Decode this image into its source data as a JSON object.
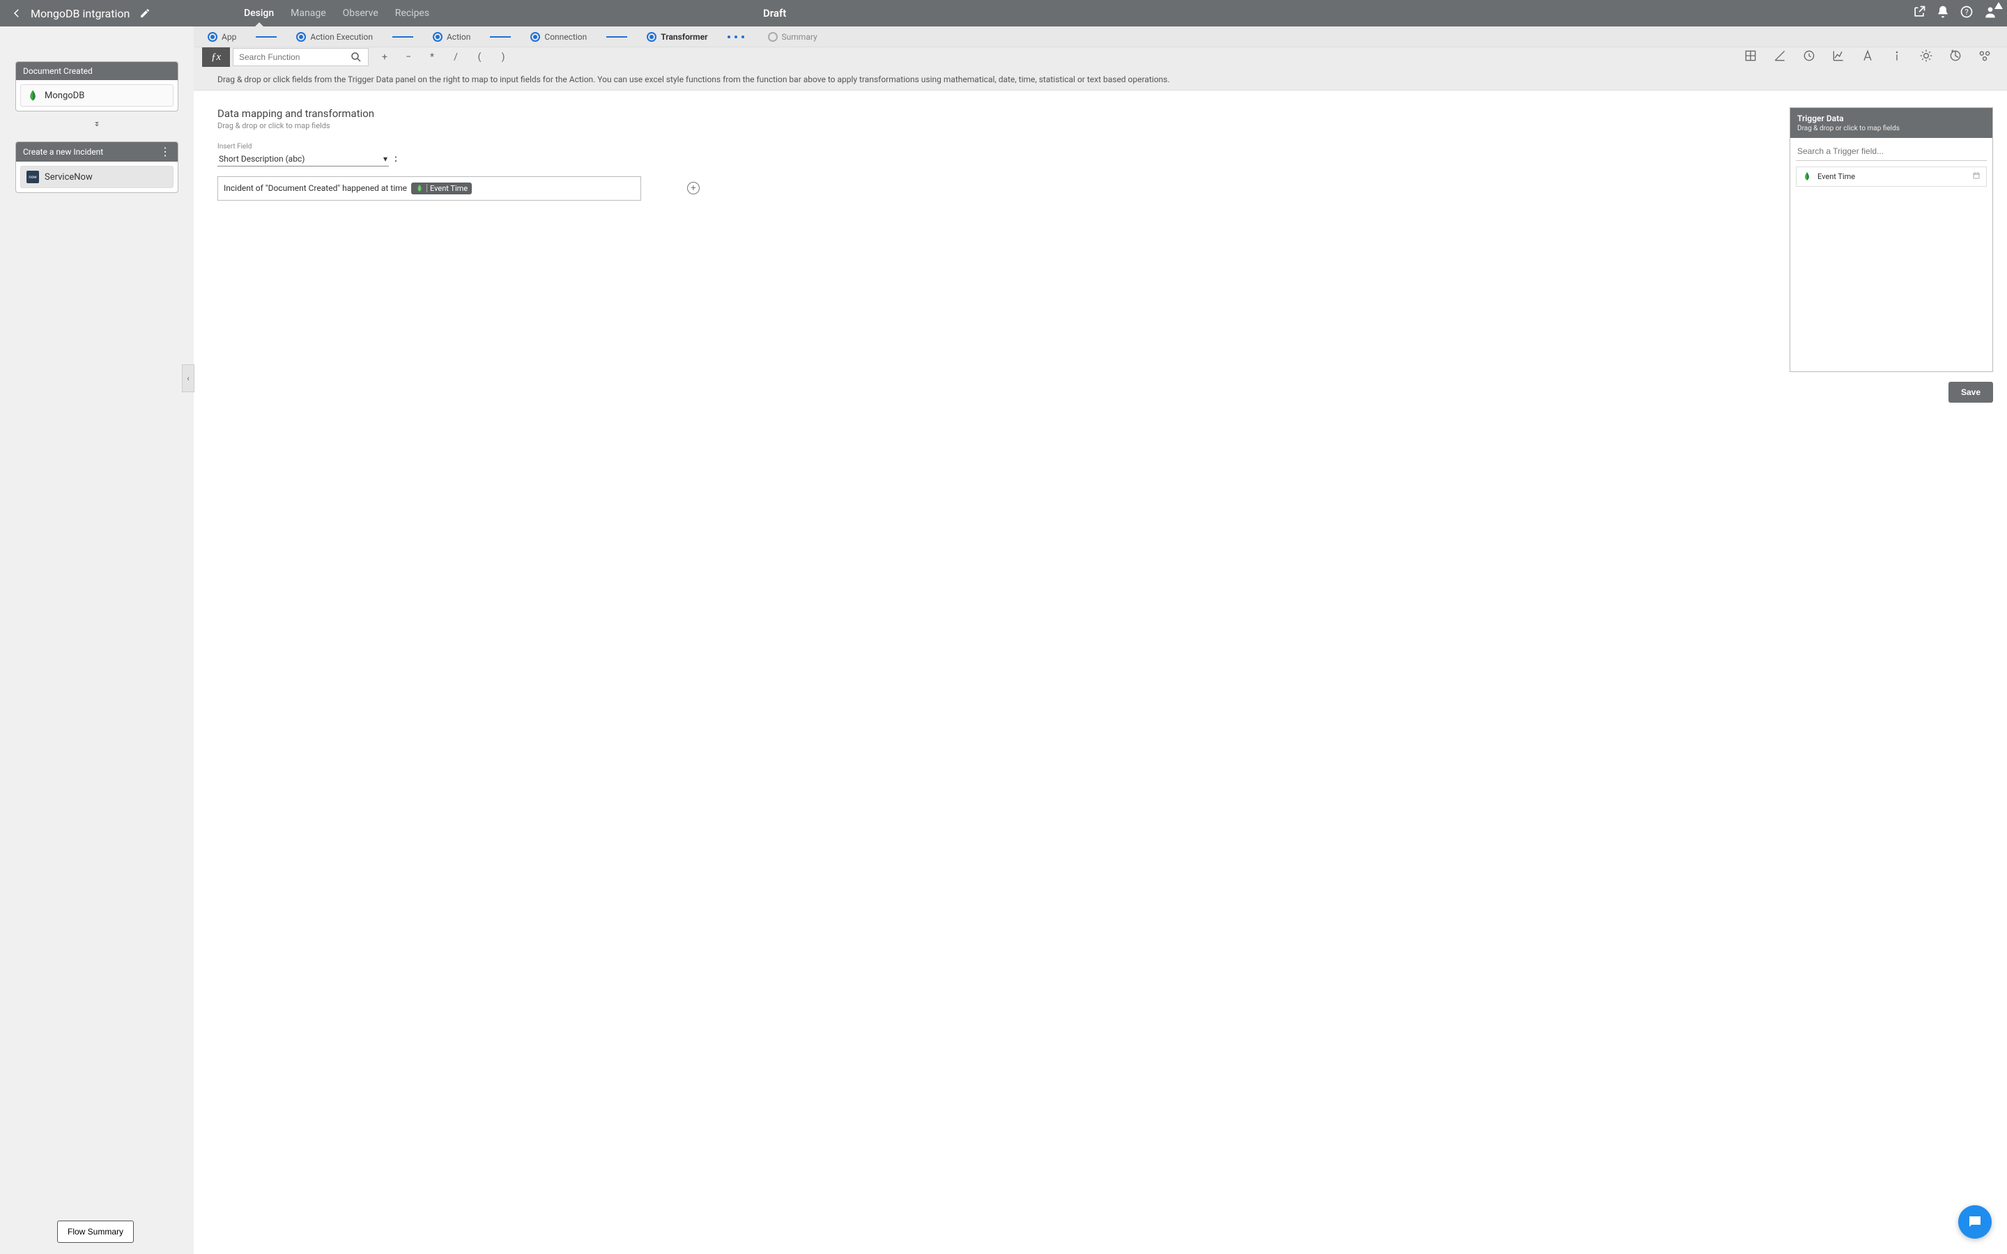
{
  "header": {
    "title": "MongoDB intgration",
    "status": "Draft",
    "tabs": [
      "Design",
      "Manage",
      "Observe",
      "Recipes"
    ],
    "active_tab": 0
  },
  "steps": [
    {
      "label": "App",
      "state": "filled"
    },
    {
      "label": "Action Execution",
      "state": "filled"
    },
    {
      "label": "Action",
      "state": "filled"
    },
    {
      "label": "Connection",
      "state": "filled"
    },
    {
      "label": "Transformer",
      "state": "filled",
      "active": true
    },
    {
      "label": "Summary",
      "state": "empty"
    }
  ],
  "sidebar": {
    "trigger_card": {
      "title": "Document Created",
      "app": "MongoDB"
    },
    "action_card": {
      "title": "Create a new Incident",
      "app": "ServiceNow"
    },
    "flow_summary": "Flow Summary"
  },
  "fnbar": {
    "search_placeholder": "Search Function",
    "ops": [
      "+",
      "−",
      "*",
      "/",
      "(",
      ")"
    ]
  },
  "hint": "Drag & drop or click fields from the Trigger Data panel on the right to map to input fields for the Action. You can use excel style functions from the function bar above to apply transformations using mathematical, date, time, statistical or text based operations.",
  "mapping": {
    "section_title": "Data mapping and transformation",
    "section_sub": "Drag & drop or click to map fields",
    "insert_field_label": "Insert Field",
    "selected_field": "Short Description (abc)",
    "expression_prefix": "Incident of \"Document Created\" happened at time",
    "chip_label": "Event Time"
  },
  "trigger_panel": {
    "title": "Trigger Data",
    "sub": "Drag & drop or click to map fields",
    "search_placeholder": "Search a Trigger field...",
    "items": [
      {
        "label": "Event Time",
        "type": "date"
      }
    ],
    "save": "Save"
  }
}
